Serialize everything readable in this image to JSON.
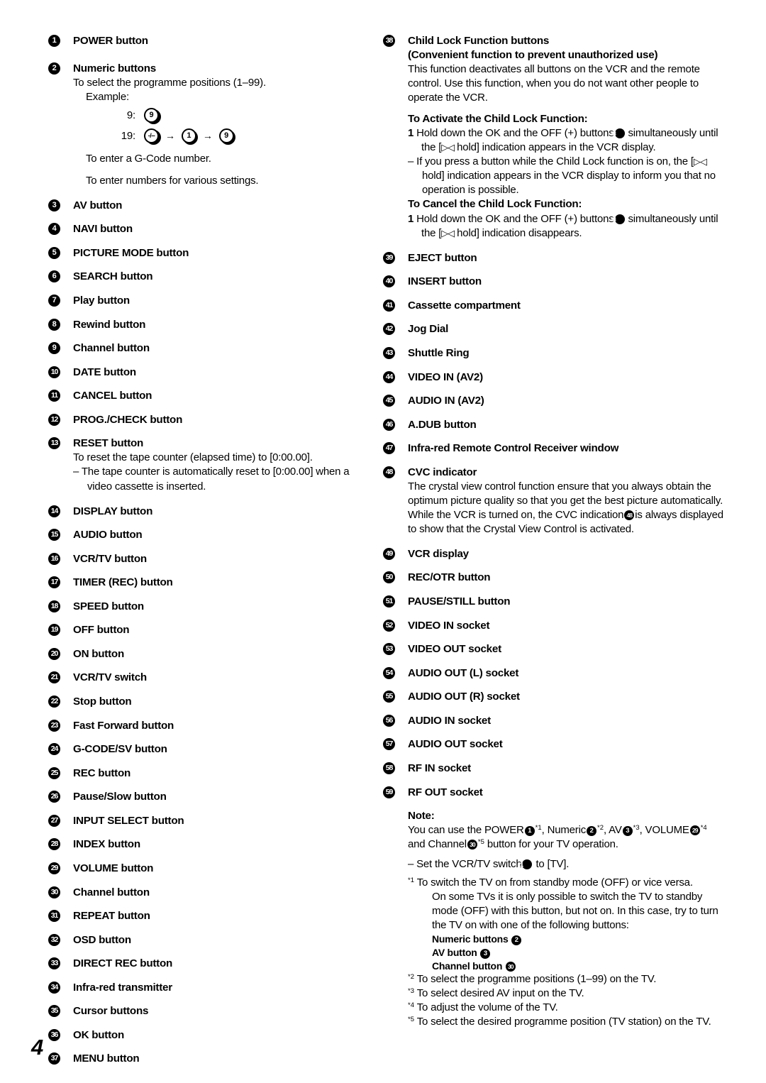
{
  "page": {
    "number": "4"
  },
  "left_column": {
    "entries": [
      {
        "num": "1",
        "title": "POWER button"
      },
      {
        "num": "2",
        "title": "Numeric buttons",
        "line1": "To select the programme positions (1–99).",
        "example_label": "Example:",
        "ex1_label": "9:",
        "ex1_key": "9",
        "ex2_label": "19:",
        "ex2_key1": "-/--",
        "ex2_key2": "1",
        "ex2_key3": "9",
        "arrow": "→",
        "line2": "To enter a G-Code number.",
        "line3": "To enter numbers for various settings."
      },
      {
        "num": "3",
        "title": "AV button"
      },
      {
        "num": "4",
        "title": "NAVI button"
      },
      {
        "num": "5",
        "title": "PICTURE MODE button"
      },
      {
        "num": "6",
        "title": "SEARCH button"
      },
      {
        "num": "7",
        "title": "Play button"
      },
      {
        "num": "8",
        "title": "Rewind button"
      },
      {
        "num": "9",
        "title": "Channel button"
      },
      {
        "num": "10",
        "title": "DATE button"
      },
      {
        "num": "11",
        "title": "CANCEL button"
      },
      {
        "num": "12",
        "title": "PROG./CHECK button"
      },
      {
        "num": "13",
        "title": "RESET button",
        "line1": "To reset the tape counter (elapsed time) to [0:00.00].",
        "line2": "– The tape counter is automatically reset to [0:00.00] when a video cassette is inserted."
      },
      {
        "num": "14",
        "title": "DISPLAY button"
      },
      {
        "num": "15",
        "title": "AUDIO button"
      },
      {
        "num": "16",
        "title": "VCR/TV button"
      },
      {
        "num": "17",
        "title": "TIMER (REC) button"
      },
      {
        "num": "18",
        "title": "SPEED button"
      },
      {
        "num": "19",
        "title": "OFF button"
      },
      {
        "num": "20",
        "title": "ON button"
      },
      {
        "num": "21",
        "title": "VCR/TV switch"
      },
      {
        "num": "22",
        "title": "Stop button"
      },
      {
        "num": "23",
        "title": "Fast Forward button"
      },
      {
        "num": "24",
        "title": "G-CODE/SV button"
      },
      {
        "num": "25",
        "title": "REC button"
      },
      {
        "num": "26",
        "title": "Pause/Slow button"
      },
      {
        "num": "27",
        "title": "INPUT SELECT button"
      },
      {
        "num": "28",
        "title": "INDEX button"
      },
      {
        "num": "29",
        "title": "VOLUME button"
      },
      {
        "num": "30",
        "title": "Channel button"
      },
      {
        "num": "31",
        "title": "REPEAT button"
      },
      {
        "num": "32",
        "title": "OSD button"
      },
      {
        "num": "33",
        "title": "DIRECT REC button"
      },
      {
        "num": "34",
        "title": "Infra-red transmitter"
      },
      {
        "num": "35",
        "title": "Cursor buttons"
      },
      {
        "num": "36",
        "title": "OK button"
      },
      {
        "num": "37",
        "title": "MENU button"
      }
    ]
  },
  "right_column": {
    "child_lock": {
      "num": "38",
      "title": "Child Lock Function buttons",
      "subtitle": "(Convenient function to prevent unauthorized use)",
      "intro": "This function deactivates all buttons on the VCR and the remote control. Use this function, when you do not want other people to operate the VCR.",
      "activate_head": "To Activate the Child Lock Function:",
      "activate_step_num": "1",
      "activate_step_a": "Hold down the OK and the OFF (+) buttons",
      "activate_step_b": "simultaneously until the [",
      "hold_symbol": "▷◁",
      "activate_step_c": " hold] indication appears in the VCR display.",
      "dash_note_a": "– If you press a button while the Child Lock function is on, the [",
      "dash_note_b": " hold] indication appears in the VCR display to inform you that no operation is possible.",
      "cancel_head": "To Cancel the Child Lock Function:",
      "cancel_step_num": "1",
      "cancel_step_a": "Hold down the OK and the OFF (+) buttons",
      "cancel_step_b": "simultaneously until the [",
      "cancel_step_c": " hold] indication disappears."
    },
    "entries": [
      {
        "num": "39",
        "title": "EJECT button"
      },
      {
        "num": "40",
        "title": "INSERT button"
      },
      {
        "num": "41",
        "title": "Cassette compartment"
      },
      {
        "num": "42",
        "title": "Jog Dial"
      },
      {
        "num": "43",
        "title": "Shuttle Ring"
      },
      {
        "num": "44",
        "title": "VIDEO IN (AV2)"
      },
      {
        "num": "45",
        "title": "AUDIO IN (AV2)"
      },
      {
        "num": "46",
        "title": "A.DUB button"
      },
      {
        "num": "47",
        "title": "Infra-red Remote Control Receiver window"
      }
    ],
    "cvc": {
      "num": "48",
      "title": "CVC indicator",
      "para1": "The crystal view control function ensure that you always obtain the optimum picture quality so that you get the best picture automatically.",
      "para2_a": "While the VCR is turned on, the CVC indication",
      "para2_ref": "48",
      "para2_b": "is always displayed to show that the Crystal View Control is activated."
    },
    "entries2": [
      {
        "num": "49",
        "title": "VCR display"
      },
      {
        "num": "50",
        "title": "REC/OTR button"
      },
      {
        "num": "51",
        "title": "PAUSE/STILL button"
      },
      {
        "num": "52",
        "title": "VIDEO IN socket"
      },
      {
        "num": "53",
        "title": "VIDEO OUT socket"
      },
      {
        "num": "54",
        "title": "AUDIO OUT (L) socket"
      },
      {
        "num": "55",
        "title": "AUDIO OUT (R) socket"
      },
      {
        "num": "56",
        "title": "AUDIO IN socket"
      },
      {
        "num": "57",
        "title": "AUDIO OUT socket"
      },
      {
        "num": "58",
        "title": "RF IN socket"
      },
      {
        "num": "59",
        "title": "RF OUT socket"
      }
    ],
    "note": {
      "head": "Note:",
      "p1_a": "You can use the POWER",
      "p1_ref1": "1",
      "p1_fn1": "*1",
      "p1_b": ", Numeric",
      "p1_ref2": "2",
      "p1_fn2": "*2",
      "p1_c": ", AV",
      "p1_ref3": "3",
      "p1_fn3": "*3",
      "p1_d": ", VOLUME",
      "p1_ref4": "29",
      "p1_fn4": "*4",
      "p1_e": "and Channel",
      "p1_ref5": "30",
      "p1_fn5": "*5",
      "p1_f": "button for your TV operation.",
      "dash_a": "– Set the VCR/TV switch",
      "dash_ref": "21",
      "dash_b": "to [TV].",
      "footnotes": [
        {
          "mark": "*1",
          "text": "To switch the TV on from standby mode (OFF) or vice versa.",
          "text2": "On some TVs it is only possible to switch the TV to standby mode (OFF) with this button, but not on. In this case, try to turn the TV on with one of the following buttons:",
          "list": [
            {
              "label": "Numeric buttons",
              "ref": "2"
            },
            {
              "label": "AV button",
              "ref": "3"
            },
            {
              "label": "Channel button",
              "ref": "30"
            }
          ]
        },
        {
          "mark": "*2",
          "text": "To select the programme positions (1–99) on the TV."
        },
        {
          "mark": "*3",
          "text": "To select desired AV input on the TV."
        },
        {
          "mark": "*4",
          "text": "To adjust the volume of the TV."
        },
        {
          "mark": "*5",
          "text": "To select the desired programme position (TV station) on the TV."
        }
      ]
    }
  }
}
